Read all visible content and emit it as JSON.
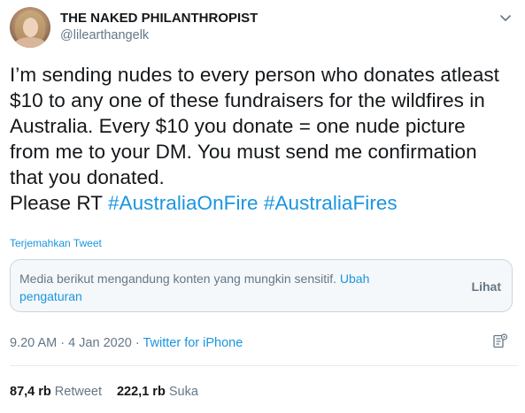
{
  "author": {
    "display_name": "THE NAKED PHILANTHROPIST",
    "handle": "@lilearthangelk"
  },
  "tweet": {
    "lines": [
      "I’m sending nudes to every person who donates atleast",
      "$10 to any one of these fundraisers for the wildfires in",
      "Australia. Every $10 you donate = one nude picture",
      "from me to your DM. You must send me confirmation",
      "that you donated."
    ],
    "last_line_prefix": "Please RT ",
    "hashtags": [
      "#AustraliaOnFire",
      "#AustraliaFires"
    ]
  },
  "translate_label": "Terjemahkan Tweet",
  "sensitive": {
    "message": "Media berikut mengandung konten yang mungkin sensitif.",
    "link": "Ubah pengaturan",
    "view_label": "Lihat"
  },
  "meta": {
    "time": "9.20 AM",
    "separator": " · ",
    "date": "4 Jan 2020",
    "source": "Twitter for iPhone"
  },
  "stats": {
    "retweets_count": "87,4 rb",
    "retweets_label": "Retweet",
    "likes_count": "222,1 rb",
    "likes_label": "Suka"
  },
  "icons": {
    "caret": "chevron-down-icon",
    "analytics": "analytics-icon"
  },
  "colors": {
    "link": "#1b95e0",
    "secondary_text": "#657786",
    "primary_text": "#14171a",
    "border": "#ccd6dd"
  }
}
